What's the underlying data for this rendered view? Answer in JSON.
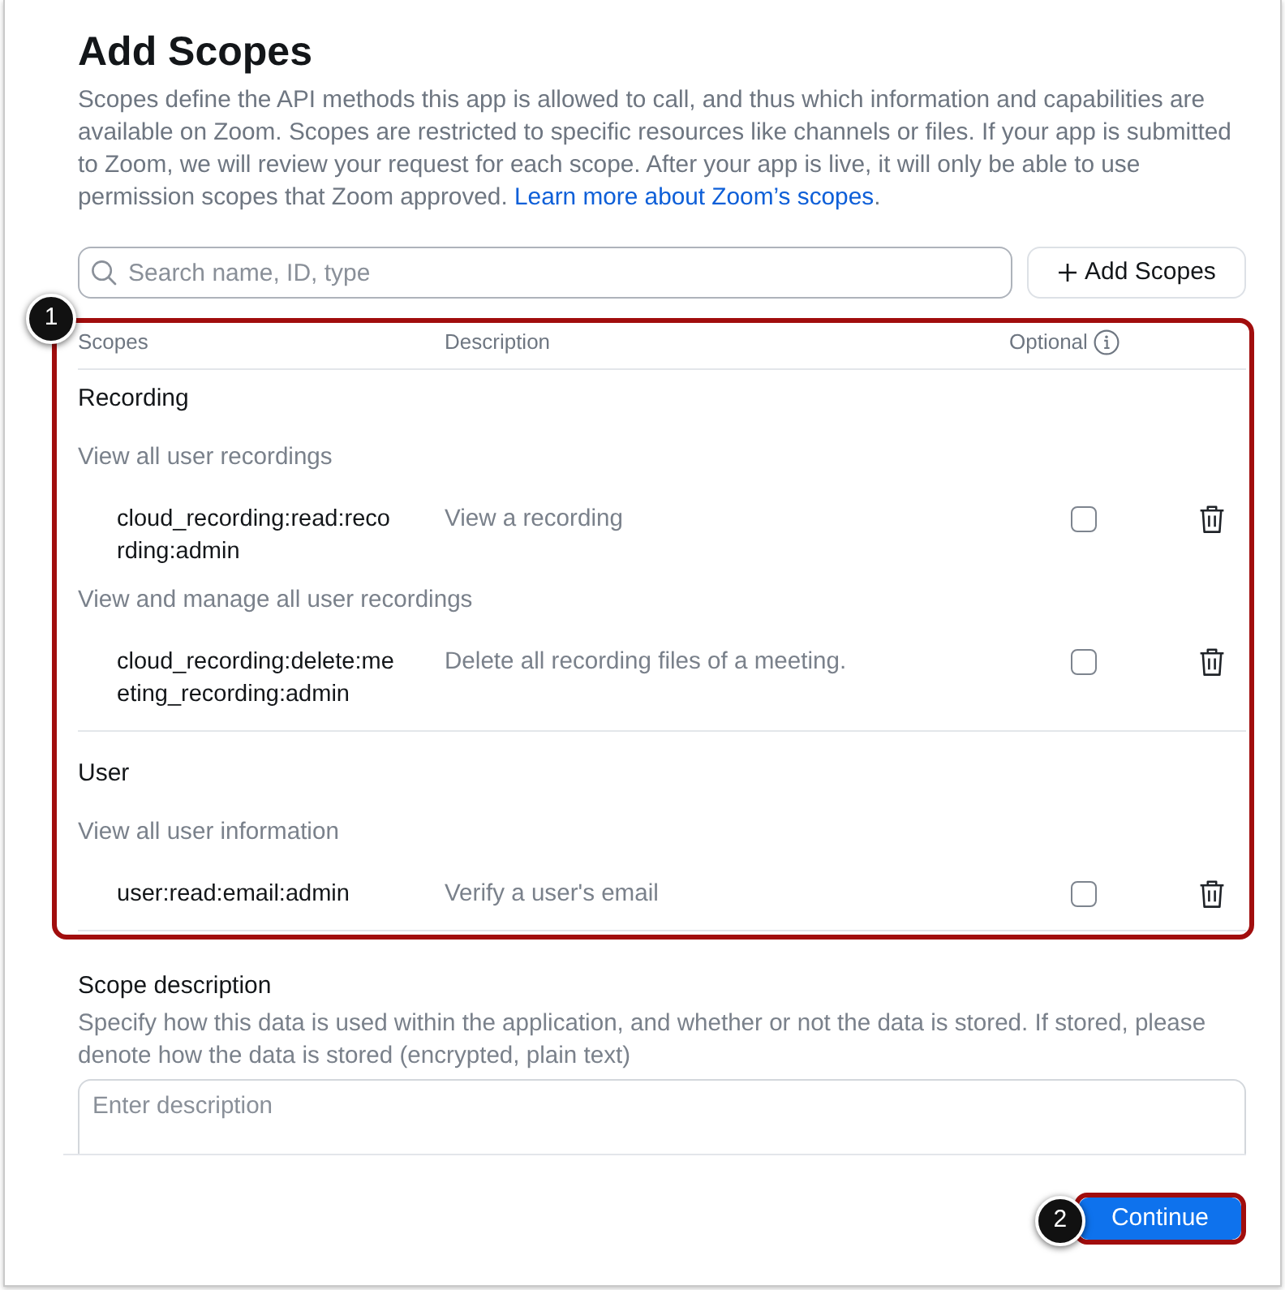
{
  "title": "Add Scopes",
  "intro": {
    "text": "Scopes define the API methods this app is allowed to call, and thus which information and capabilities are available on Zoom. Scopes are restricted to specific resources like channels or files. If your app is submitted to Zoom, we will review your request for each scope. After your app is live, it will only be able to use permission scopes that Zoom approved.",
    "link": "Learn more about Zoom’s scopes",
    "tail": "."
  },
  "search": {
    "placeholder": "Search name, ID, type"
  },
  "add_button": {
    "label": "Add Scopes"
  },
  "table": {
    "callout": "1",
    "columns": [
      {
        "label": "Scopes"
      },
      {
        "label": "Description"
      },
      {
        "label": "Optional",
        "info_icon": true
      }
    ],
    "groups": [
      {
        "name": "Recording",
        "sections": [
          {
            "title": "View all user recordings",
            "scopes": [
              {
                "id": "cloud_recording:read:recording:admin",
                "description": "View a recording",
                "optional": false
              }
            ]
          },
          {
            "title": "View and manage all user recordings",
            "scopes": [
              {
                "id": "cloud_recording:delete:meeting_recording:admin",
                "description": "Delete all recording files of a meeting.",
                "optional": false
              }
            ]
          }
        ]
      },
      {
        "name": "User",
        "sections": [
          {
            "title": "View all user information",
            "scopes": [
              {
                "id": "user:read:email:admin",
                "description": "Verify a user's email",
                "optional": false
              }
            ]
          }
        ]
      }
    ]
  },
  "scope_description": {
    "label": "Scope description",
    "help": "Specify how this data is used within the application, and whether or not the data is stored. If stored, please denote how the data is stored (encrypted, plain text)",
    "placeholder": "Enter description"
  },
  "continue_button": {
    "label": "Continue",
    "callout": "2"
  }
}
